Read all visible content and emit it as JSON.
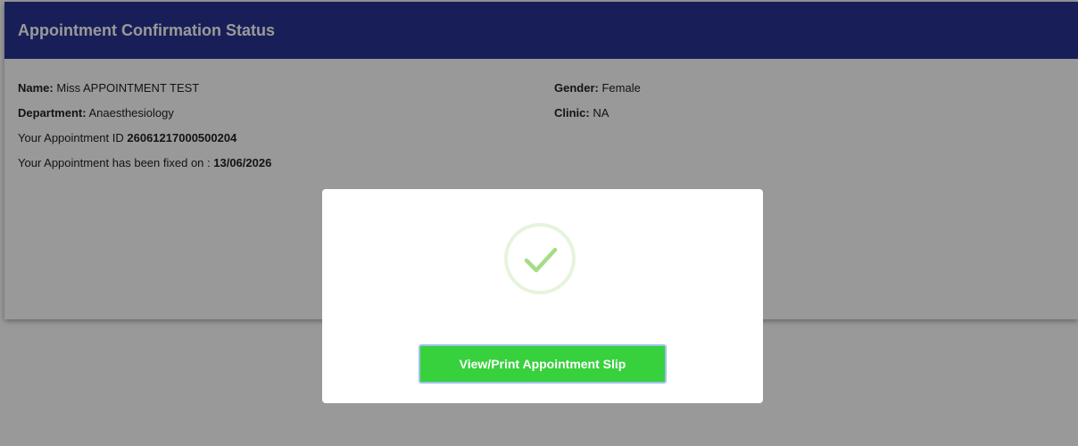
{
  "header": {
    "title": "Appointment Confirmation Status"
  },
  "details": {
    "name_label": "Name:",
    "name_value": "Miss APPOINTMENT TEST",
    "department_label": "Department:",
    "department_value": "Anaesthesiology",
    "appointment_id_label": "Your Appointment ID",
    "appointment_id_value": "26061217000500204",
    "fixed_on_label": "Your Appointment has been fixed on :",
    "fixed_on_value": "13/06/2026",
    "gender_label": "Gender:",
    "gender_value": "Female",
    "clinic_label": "Clinic:",
    "clinic_value": "NA"
  },
  "modal": {
    "icon": "checkmark-icon",
    "button_label": "View/Print Appointment Slip"
  },
  "colors": {
    "header_bg": "#283593",
    "button_bg": "#36d13d",
    "check_color": "#a5dc86",
    "overlay": "rgba(0,0,0,0.4)"
  }
}
